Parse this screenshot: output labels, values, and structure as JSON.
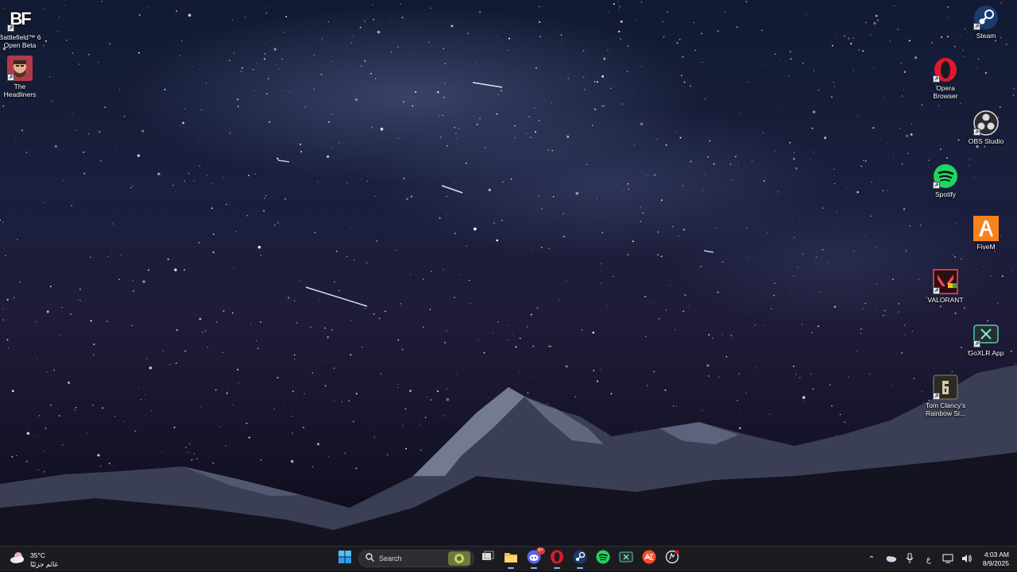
{
  "desktop": {
    "left_icons": [
      {
        "label_line1": "Battlefield™ 6",
        "label_line2": "Open Beta",
        "icon": "battlefield-icon"
      },
      {
        "label_line1": "The",
        "label_line2": "Headliners",
        "icon": "headliners-icon"
      }
    ],
    "right_icons": [
      {
        "label_line1": "Steam",
        "label_line2": "",
        "icon": "steam-icon"
      },
      {
        "label_line1": "Opera",
        "label_line2": "Browser",
        "icon": "opera-icon"
      },
      {
        "label_line1": "OBS Studio",
        "label_line2": "",
        "icon": "obs-icon"
      },
      {
        "label_line1": "Spotify",
        "label_line2": "",
        "icon": "spotify-icon"
      },
      {
        "label_line1": "FiveM",
        "label_line2": "",
        "icon": "fivem-icon"
      },
      {
        "label_line1": "VALORANT",
        "label_line2": "",
        "icon": "valorant-icon"
      },
      {
        "label_line1": "GoXLR App",
        "label_line2": "",
        "icon": "goxlr-icon"
      },
      {
        "label_line1": "Tom Clancy's",
        "label_line2": "Rainbow Si...",
        "icon": "rainbow-six-icon"
      }
    ],
    "logo_text": "BF"
  },
  "taskbar": {
    "weather_temp": "35°C",
    "weather_desc": "غائم جزئيًا",
    "search_label": "Search",
    "discord_badge": "9+",
    "apps": [
      "start-icon",
      "task-view-icon",
      "file-explorer-icon",
      "discord-icon",
      "opera-icon",
      "steam-icon",
      "spotify-icon",
      "goxlr-icon",
      "ea-icon",
      "rockstar-icon"
    ],
    "tray_lang": "ع",
    "clock_time": "4:03 AM",
    "clock_date": "8/9/2025"
  },
  "colors": {
    "taskbar_bg": "#1c1c20",
    "accent": "#8ab4ff",
    "opera_red": "#e0182d",
    "spotify_green": "#1ed760",
    "steam_blue": "#1b3b6f",
    "fivem_orange": "#f5821f"
  }
}
